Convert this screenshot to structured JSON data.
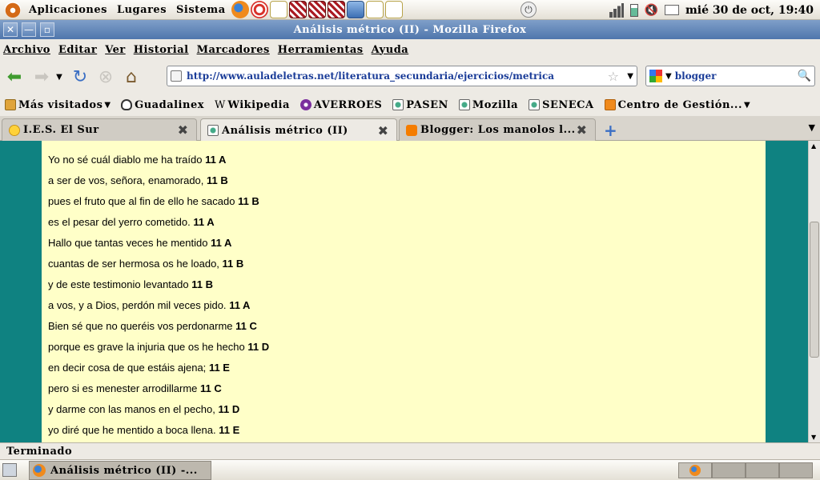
{
  "top_panel": {
    "menus": [
      "Aplicaciones",
      "Lugares",
      "Sistema"
    ],
    "clock": "mié 30 de oct, 19:40"
  },
  "window": {
    "title": "Análisis métrico (II) - Mozilla Firefox"
  },
  "menubar": {
    "items": [
      "Archivo",
      "Editar",
      "Ver",
      "Historial",
      "Marcadores",
      "Herramientas",
      "Ayuda"
    ]
  },
  "navbar": {
    "url": "http://www.auladeletras.net/literatura_secundaria/ejercicios/metrica",
    "search_value": "blogger"
  },
  "bookmarks": {
    "items": [
      "Más visitados",
      "Guadalinex",
      "Wikipedia",
      "AVERROES",
      "PASEN",
      "Mozilla",
      "SENECA",
      "Centro de Gestión..."
    ]
  },
  "tabs": [
    {
      "label": "I.E.S. El Sur",
      "active": false
    },
    {
      "label": "Análisis métrico (II)",
      "active": true
    },
    {
      "label": "Blogger: Los manolos l...",
      "active": false
    }
  ],
  "content": {
    "verses": [
      {
        "text": "Yo no sé cuál diablo me ha traído",
        "meter": "11 A"
      },
      {
        "text": "a ser de vos, señora, enamorado,",
        "meter": "11 B"
      },
      {
        "text": "pues el fruto que al fin de ello he sacado",
        "meter": "11 B"
      },
      {
        "text": "es el pesar del yerro cometido.",
        "meter": "11 A"
      },
      {
        "text": "Hallo que tantas veces he mentido",
        "meter": "11 A"
      },
      {
        "text": "cuantas de ser hermosa os he loado,",
        "meter": "11 B"
      },
      {
        "text": "y de este testimonio levantado",
        "meter": "11 B"
      },
      {
        "text": "a vos, y a Dios, perdón mil veces pido.",
        "meter": "11 A"
      },
      {
        "text": "Bien sé que no queréis vos perdonarme",
        "meter": "11 C"
      },
      {
        "text": "porque es grave la injuria que os he hecho",
        "meter": "11 D"
      },
      {
        "text": "en decir cosa de que estáis ajena;",
        "meter": "11 E"
      },
      {
        "text": "pero si es menester arrodillarme",
        "meter": "11 C"
      },
      {
        "text": "y darme con las manos en el pecho,",
        "meter": "11 D"
      },
      {
        "text": "yo diré que he mentido a boca llena.",
        "meter": "11 E"
      }
    ]
  },
  "statusbar": {
    "text": "Terminado"
  },
  "taskbar": {
    "window_label": "Análisis métrico (II) -..."
  },
  "colors": {
    "page_background": "#0f8281",
    "article_background": "#ffffc8",
    "titlebar": "#5f84b8",
    "url_text": "#1a3c98"
  }
}
